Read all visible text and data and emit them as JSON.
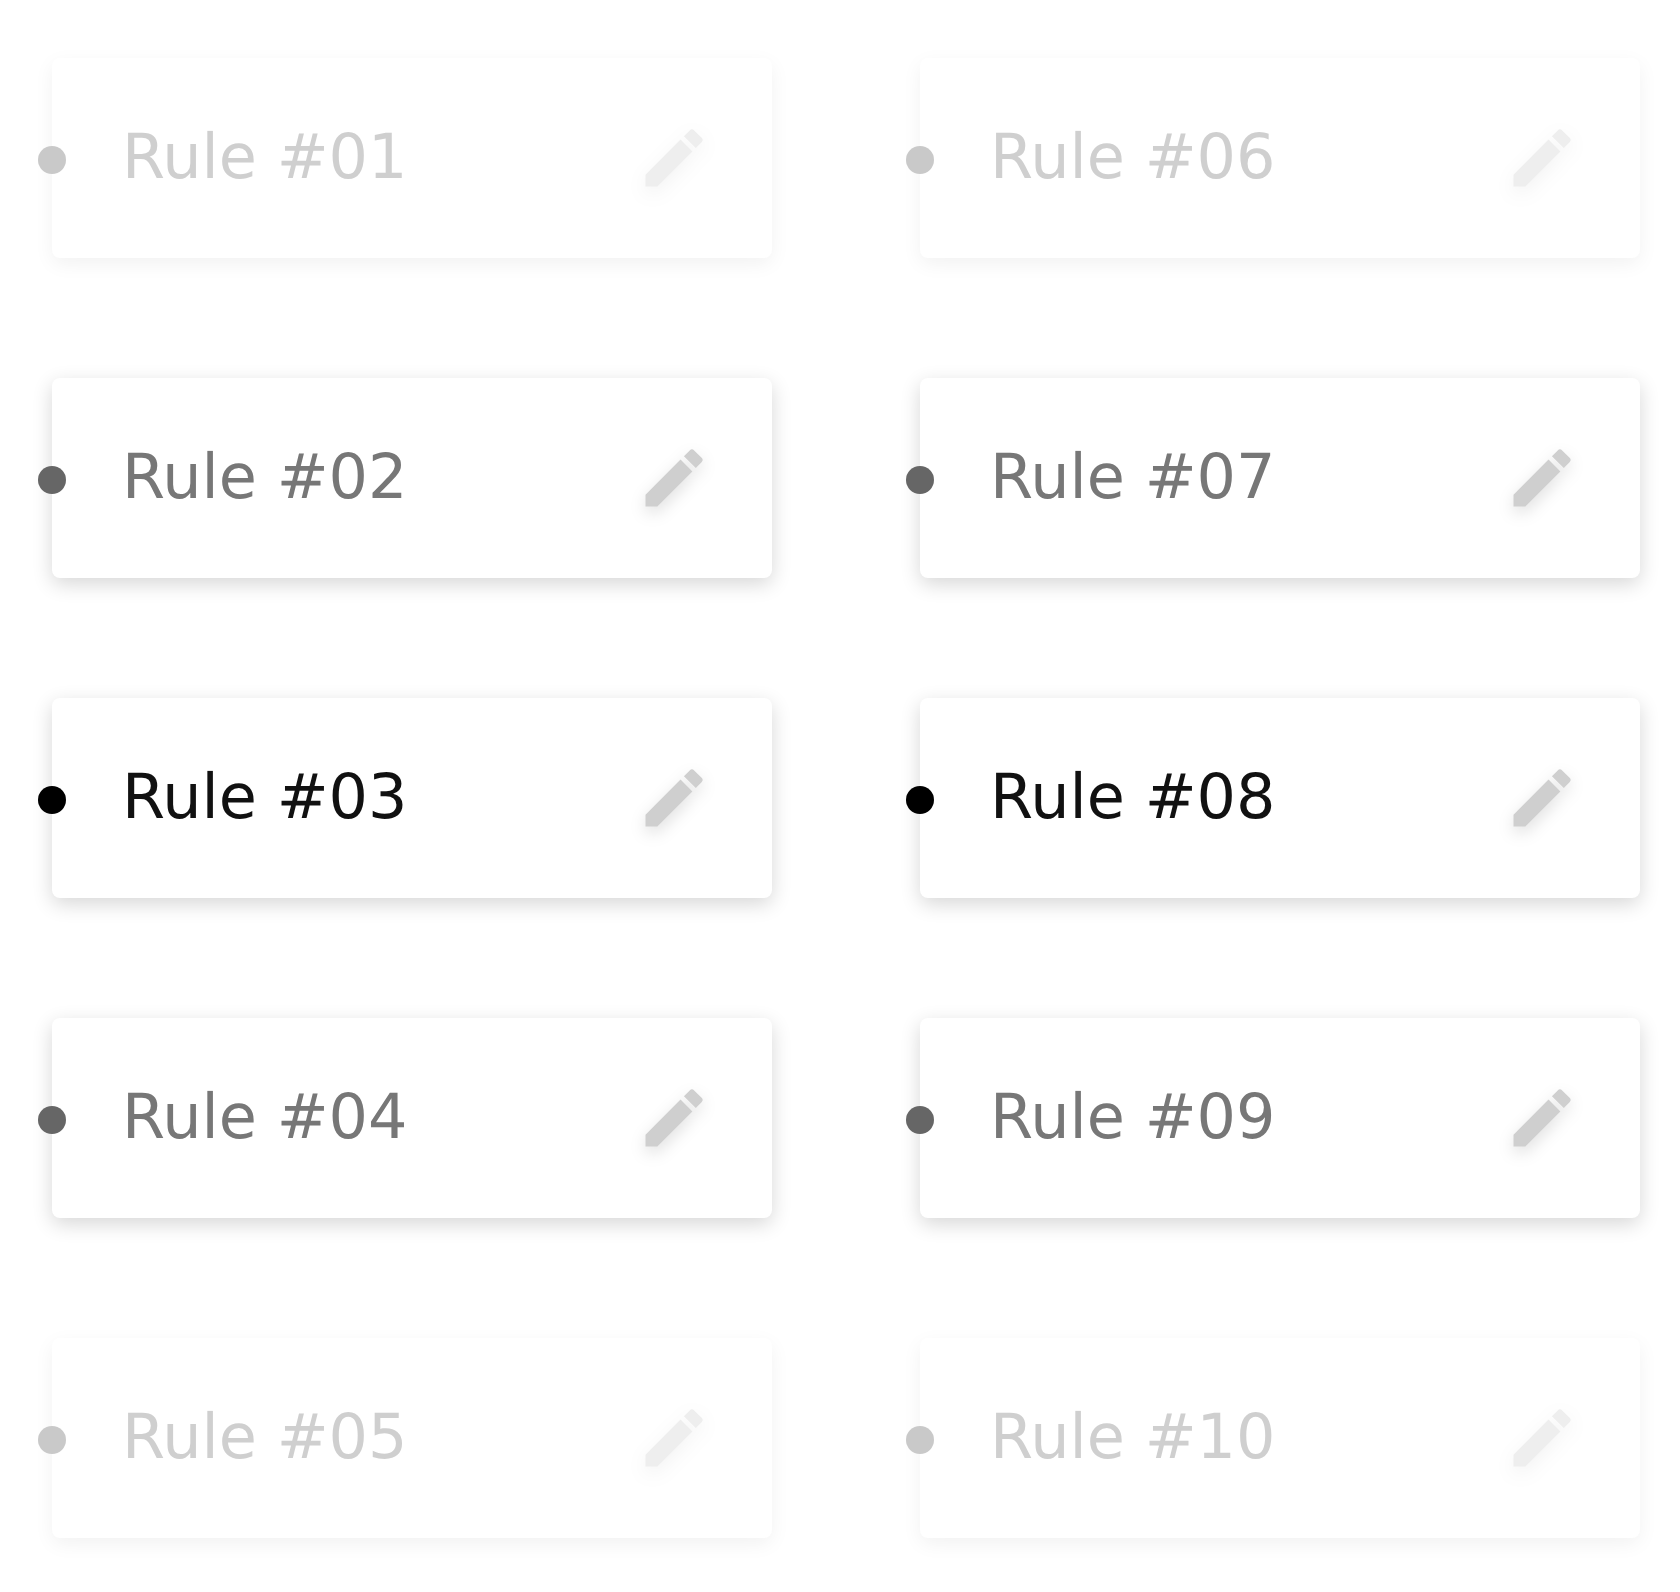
{
  "columns": [
    {
      "items": [
        {
          "label": "Rule #01",
          "selected": false
        },
        {
          "label": "Rule #02",
          "selected": false
        },
        {
          "label": "Rule #03",
          "selected": true
        },
        {
          "label": "Rule #04",
          "selected": false
        },
        {
          "label": "Rule #05",
          "selected": false
        }
      ]
    },
    {
      "items": [
        {
          "label": "Rule #06",
          "selected": false
        },
        {
          "label": "Rule #07",
          "selected": false
        },
        {
          "label": "Rule #08",
          "selected": true
        },
        {
          "label": "Rule #09",
          "selected": false
        },
        {
          "label": "Rule #10",
          "selected": false
        }
      ]
    }
  ]
}
